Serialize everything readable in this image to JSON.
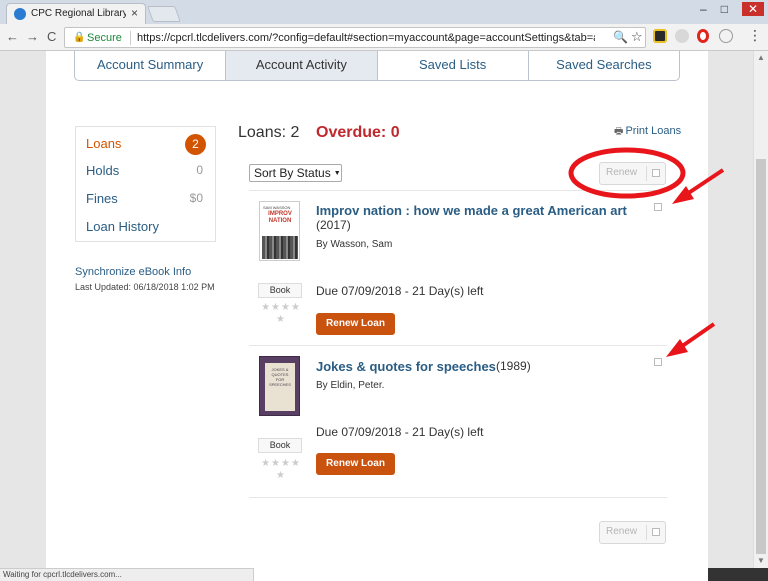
{
  "browser": {
    "tab_title": "CPC Regional Library Cat",
    "tab_close": "×",
    "url_secure": "Secure",
    "url": "https://cpcrl.tlcdelivers.com/?config=default#section=myaccount&page=accountSettings&tab=account...",
    "status_text": "Waiting for cpcrl.tlcdelivers.com...",
    "back": "←",
    "forward": "→",
    "reload": "C",
    "zoom": "🔍",
    "star": "☆",
    "menu": "⋮",
    "minimize": "–",
    "maximize": "□",
    "close": "✕"
  },
  "account_tabs": [
    {
      "label": "Account Summary"
    },
    {
      "label": "Account Activity"
    },
    {
      "label": "Saved Lists"
    },
    {
      "label": "Saved Searches"
    }
  ],
  "sidebar": {
    "items": [
      {
        "label": "Loans",
        "count": "2"
      },
      {
        "label": "Holds",
        "count": "0"
      },
      {
        "label": "Fines",
        "count": "$0"
      },
      {
        "label": "Loan History"
      }
    ],
    "sync_label": "Synchronize eBook Info",
    "last_updated": "Last Updated: 06/18/2018 1:02 PM"
  },
  "main": {
    "loans_label": "Loans: 2",
    "overdue_label": "Overdue: 0",
    "print_label": "Print Loans",
    "sort_value": "Sort By Status",
    "renew_label": "Renew"
  },
  "loans": [
    {
      "title": "Improv nation : how we made a great American art",
      "year": "(2017)",
      "author": "By Wasson, Sam",
      "format": "Book",
      "due": "Due 07/09/2018 - 21 Day(s) left",
      "renew_button": "Renew Loan",
      "cover_top": "SAM WASSON",
      "cover_title": "IMPROV NATION"
    },
    {
      "title": "Jokes & quotes for speeches",
      "year": "(1989)",
      "author": "By Eldin, Peter.",
      "format": "Book",
      "due": "Due 07/09/2018 - 21 Day(s) left",
      "renew_button": "Renew Loan",
      "cover_title": "JOKES & QUOTES FOR SPEECHES"
    }
  ],
  "colors": {
    "link": "#2a5d84",
    "accent_orange": "#d35400",
    "overdue_red": "#c0282d",
    "annotation_red": "#e8161b"
  }
}
